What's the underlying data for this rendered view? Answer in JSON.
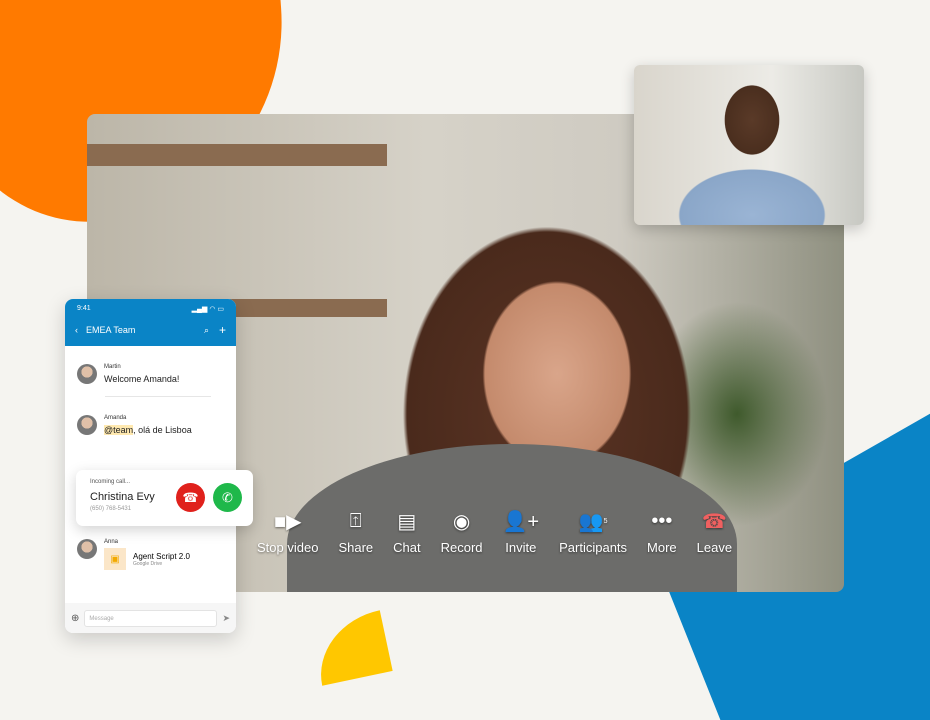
{
  "colors": {
    "accent": "#0a84c6",
    "orange": "#ff7a00",
    "yellow": "#ffc700",
    "decline": "#e0211c",
    "accept": "#1fb84a",
    "leave": "#f06060"
  },
  "controls": [
    {
      "label": "Stop video",
      "icon": "video-camera-icon"
    },
    {
      "label": "Share",
      "icon": "share-screen-icon"
    },
    {
      "label": "Chat",
      "icon": "chat-icon"
    },
    {
      "label": "Record",
      "icon": "record-icon"
    },
    {
      "label": "Invite",
      "icon": "add-person-icon"
    },
    {
      "label": "Participants",
      "icon": "participants-icon",
      "badge": "5"
    },
    {
      "label": "More",
      "icon": "more-icon"
    },
    {
      "label": "Leave",
      "icon": "hang-up-icon"
    }
  ],
  "phone": {
    "time": "9:41",
    "title": "EMEA Team",
    "messages": [
      {
        "name": "Martin",
        "text": "Welcome Amanda!"
      },
      {
        "name": "Amanda",
        "mention": "@team",
        "text": ", olá de Lisboa"
      },
      {
        "name": "Anna",
        "file": "Agent Script 2.0",
        "source": "Google Drive"
      }
    ],
    "placeholder": "Message"
  },
  "call": {
    "status": "Incoming call...",
    "name": "Christina Evy",
    "phone": "(650) 768-5431"
  }
}
